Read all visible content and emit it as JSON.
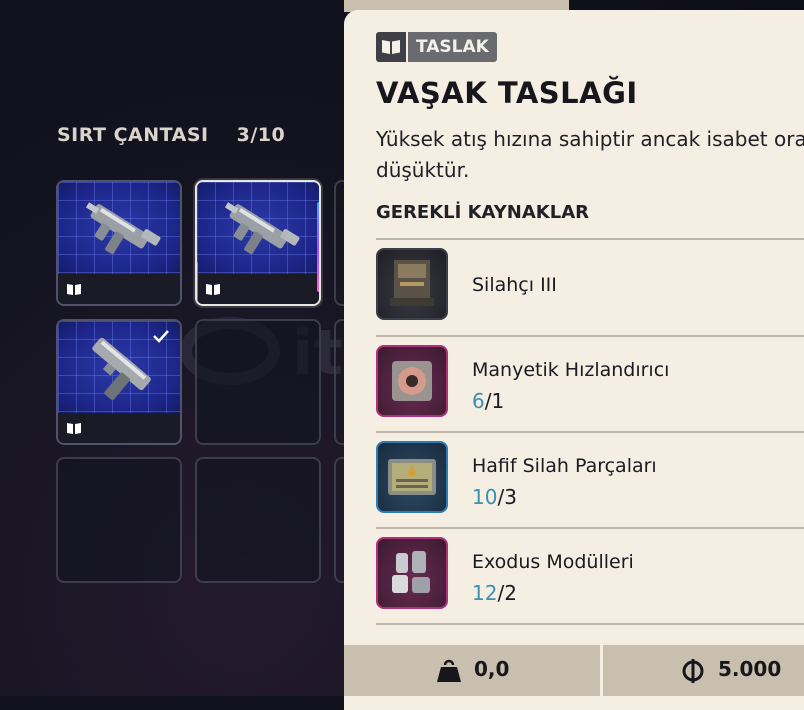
{
  "backpack": {
    "title": "SIRT ÇANTASI",
    "count": "3/10",
    "slots": [
      {
        "filled": true,
        "item_icon": "smg-blueprint"
      },
      {
        "filled": true,
        "item_icon": "smg-blueprint",
        "selected": true
      },
      {
        "filled": true,
        "item_icon": "pistol-blueprint",
        "checked": true
      },
      {
        "filled": false
      },
      {
        "filled": false
      },
      {
        "filled": false
      }
    ]
  },
  "detail": {
    "tag_icon": "book-icon",
    "tag_label": "TASLAK",
    "title": "VAŞAK TASLAĞI",
    "description": "Yüksek atış hızına sahiptir ancak isabet oranı düşüktür.",
    "requirements_heading": "GEREKLİ KAYNAKLAR",
    "requirements": [
      {
        "name": "Silahçı III",
        "have": "",
        "need": "",
        "icon": "workbench-icon",
        "rarity_color": "#2a2c36"
      },
      {
        "name": "Manyetik Hızlandırıcı",
        "have": "6",
        "need": "/1",
        "icon": "magnetic-accelerator-icon",
        "rarity_color": "#b0307a"
      },
      {
        "name": "Hafif Silah Parçaları",
        "have": "10",
        "need": "/3",
        "icon": "light-weapon-parts-icon",
        "rarity_color": "#2f7bb4"
      },
      {
        "name": "Exodus Modülleri",
        "have": "12",
        "need": "/2",
        "icon": "exodus-modules-icon",
        "rarity_color": "#b0307a"
      }
    ]
  },
  "footer": {
    "weight_icon": "weight-icon",
    "weight": "0,0",
    "currency_icon": "coin-icon",
    "price": "5.000"
  },
  "colors": {
    "panel_bg": "#f5eee3",
    "have_qty": "#3c8fb0",
    "footer_bg": "#c9bfae"
  }
}
